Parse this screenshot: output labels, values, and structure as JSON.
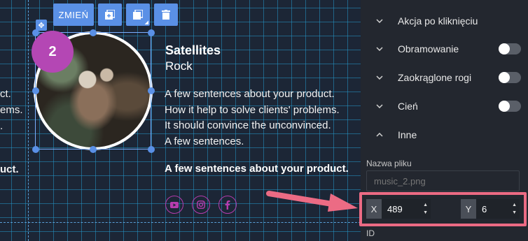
{
  "toolbar": {
    "change_label": "ZMIEŃ"
  },
  "canvas": {
    "cut_text": {
      "line1": "ct.",
      "line2": "ems.",
      "line3": ".",
      "line4": "uct."
    },
    "badge_number": "2"
  },
  "product": {
    "title": "Satellites",
    "subtitle": "Rock",
    "description": [
      "A few sentences about your product.",
      "How it help to solve clients' problems.",
      "It should convince the unconvinced.",
      "A few sentences."
    ],
    "bold_line": "A few sentences about your product.",
    "social_icons": [
      "youtube-icon",
      "instagram-icon",
      "facebook-icon"
    ]
  },
  "panel": {
    "sections": [
      {
        "label": "Akcja po kliknięciu",
        "state": "collapsed"
      },
      {
        "label": "Obramowanie",
        "state": "collapsed",
        "toggle": false
      },
      {
        "label": "Zaokrąglone rogi",
        "state": "collapsed",
        "toggle": false
      },
      {
        "label": "Cień",
        "state": "collapsed",
        "toggle": false
      },
      {
        "label": "Inne",
        "state": "expanded"
      }
    ],
    "file_name_label": "Nazwa pliku",
    "file_name_placeholder": "music_2.png",
    "x_label": "X",
    "x_value": "489",
    "y_label": "Y",
    "y_value": "6",
    "id_label": "ID"
  },
  "colors": {
    "accent_blue": "#5a90e6",
    "badge_purple": "#b447b4",
    "callout_pink": "#ec6b84",
    "panel_bg": "#23272f"
  }
}
